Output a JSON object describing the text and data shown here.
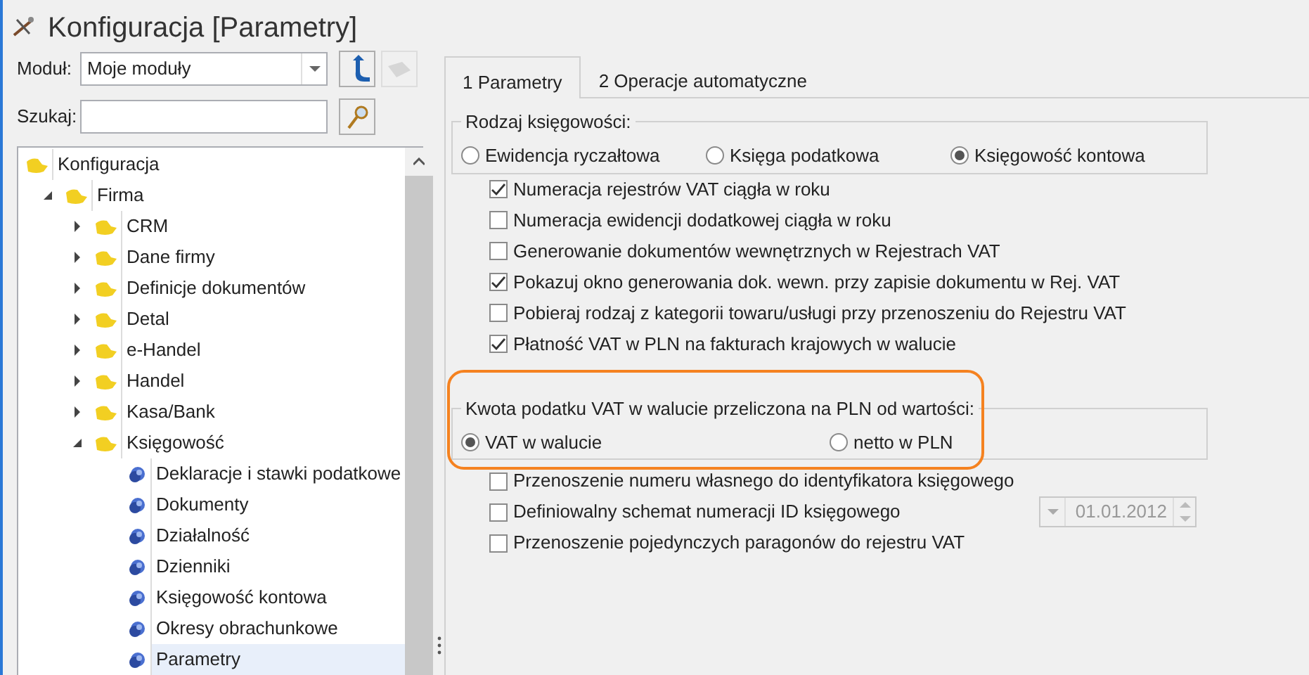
{
  "window": {
    "title": "Konfiguracja [Parametry]"
  },
  "module": {
    "label": "Moduł:",
    "value": "Moje moduły"
  },
  "search": {
    "label": "Szukaj:"
  },
  "tree": [
    {
      "label": "Konfiguracja",
      "kind": "folder",
      "selected": false,
      "children": [
        {
          "label": "Firma",
          "kind": "folder",
          "expanded": true,
          "selected": false,
          "children": [
            {
              "label": "CRM",
              "kind": "folder",
              "expanded": false,
              "selected": false
            },
            {
              "label": "Dane firmy",
              "kind": "folder",
              "expanded": false,
              "selected": false
            },
            {
              "label": "Definicje dokumentów",
              "kind": "folder",
              "expanded": false,
              "selected": false
            },
            {
              "label": "Detal",
              "kind": "folder",
              "expanded": false,
              "selected": false
            },
            {
              "label": "e-Handel",
              "kind": "folder",
              "expanded": false,
              "selected": false
            },
            {
              "label": "Handel",
              "kind": "folder",
              "expanded": false,
              "selected": false
            },
            {
              "label": "Kasa/Bank",
              "kind": "folder",
              "expanded": false,
              "selected": false
            },
            {
              "label": "Księgowość",
              "kind": "folder",
              "expanded": true,
              "selected": false,
              "children": [
                {
                  "label": "Deklaracje i stawki podatkowe",
                  "kind": "leaf",
                  "selected": false
                },
                {
                  "label": "Dokumenty",
                  "kind": "leaf",
                  "selected": false
                },
                {
                  "label": "Działalność",
                  "kind": "leaf",
                  "selected": false
                },
                {
                  "label": "Dzienniki",
                  "kind": "leaf",
                  "selected": false
                },
                {
                  "label": "Księgowość kontowa",
                  "kind": "leaf",
                  "selected": false
                },
                {
                  "label": "Okresy obrachunkowe",
                  "kind": "leaf",
                  "selected": false
                },
                {
                  "label": "Parametry",
                  "kind": "leaf",
                  "selected": true
                }
              ]
            }
          ]
        }
      ]
    }
  ],
  "tabs": [
    {
      "label": "1 Parametry",
      "selected": true
    },
    {
      "label": "2 Operacje automatyczne",
      "selected": false
    }
  ],
  "accounting_type": {
    "legend": "Rodzaj księgowości:",
    "options": [
      {
        "label": "Ewidencja ryczałtowa",
        "selected": false
      },
      {
        "label": "Księga podatkowa",
        "selected": false
      },
      {
        "label": "Księgowość kontowa",
        "selected": true
      }
    ]
  },
  "options": [
    {
      "label": "Numeracja rejestrów VAT ciągła w roku",
      "checked": true
    },
    {
      "label": "Numeracja ewidencji dodatkowej ciągła w roku",
      "checked": false
    },
    {
      "label": "Generowanie dokumentów wewnętrznych w Rejestrach VAT",
      "checked": false
    },
    {
      "label": "Pokazuj okno generowania dok. wewn. przy zapisie dokumentu w Rej. VAT",
      "checked": true
    },
    {
      "label": "Pobieraj rodzaj z kategorii towaru/usługi przy przenoszeniu do Rejestru VAT",
      "checked": false
    },
    {
      "label": "Płatność VAT w PLN na fakturach krajowych w walucie",
      "checked": true
    }
  ],
  "vat_amount": {
    "legend": "Kwota podatku VAT w walucie przeliczona na PLN od wartości:",
    "highlighted": true,
    "options": [
      {
        "label": "VAT w walucie",
        "selected": true
      },
      {
        "label": "netto w PLN",
        "selected": false
      }
    ]
  },
  "more_options": [
    {
      "label": "Przenoszenie numeru własnego do identyfikatora księgowego",
      "checked": false
    },
    {
      "label": "Definiowalny schemat numeracji ID księgowego",
      "checked": false,
      "date_field": {
        "value": "01.01.2012",
        "disabled": true
      }
    },
    {
      "label": "Przenoszenie pojedynczych paragonów do rejestru VAT",
      "checked": false
    }
  ]
}
